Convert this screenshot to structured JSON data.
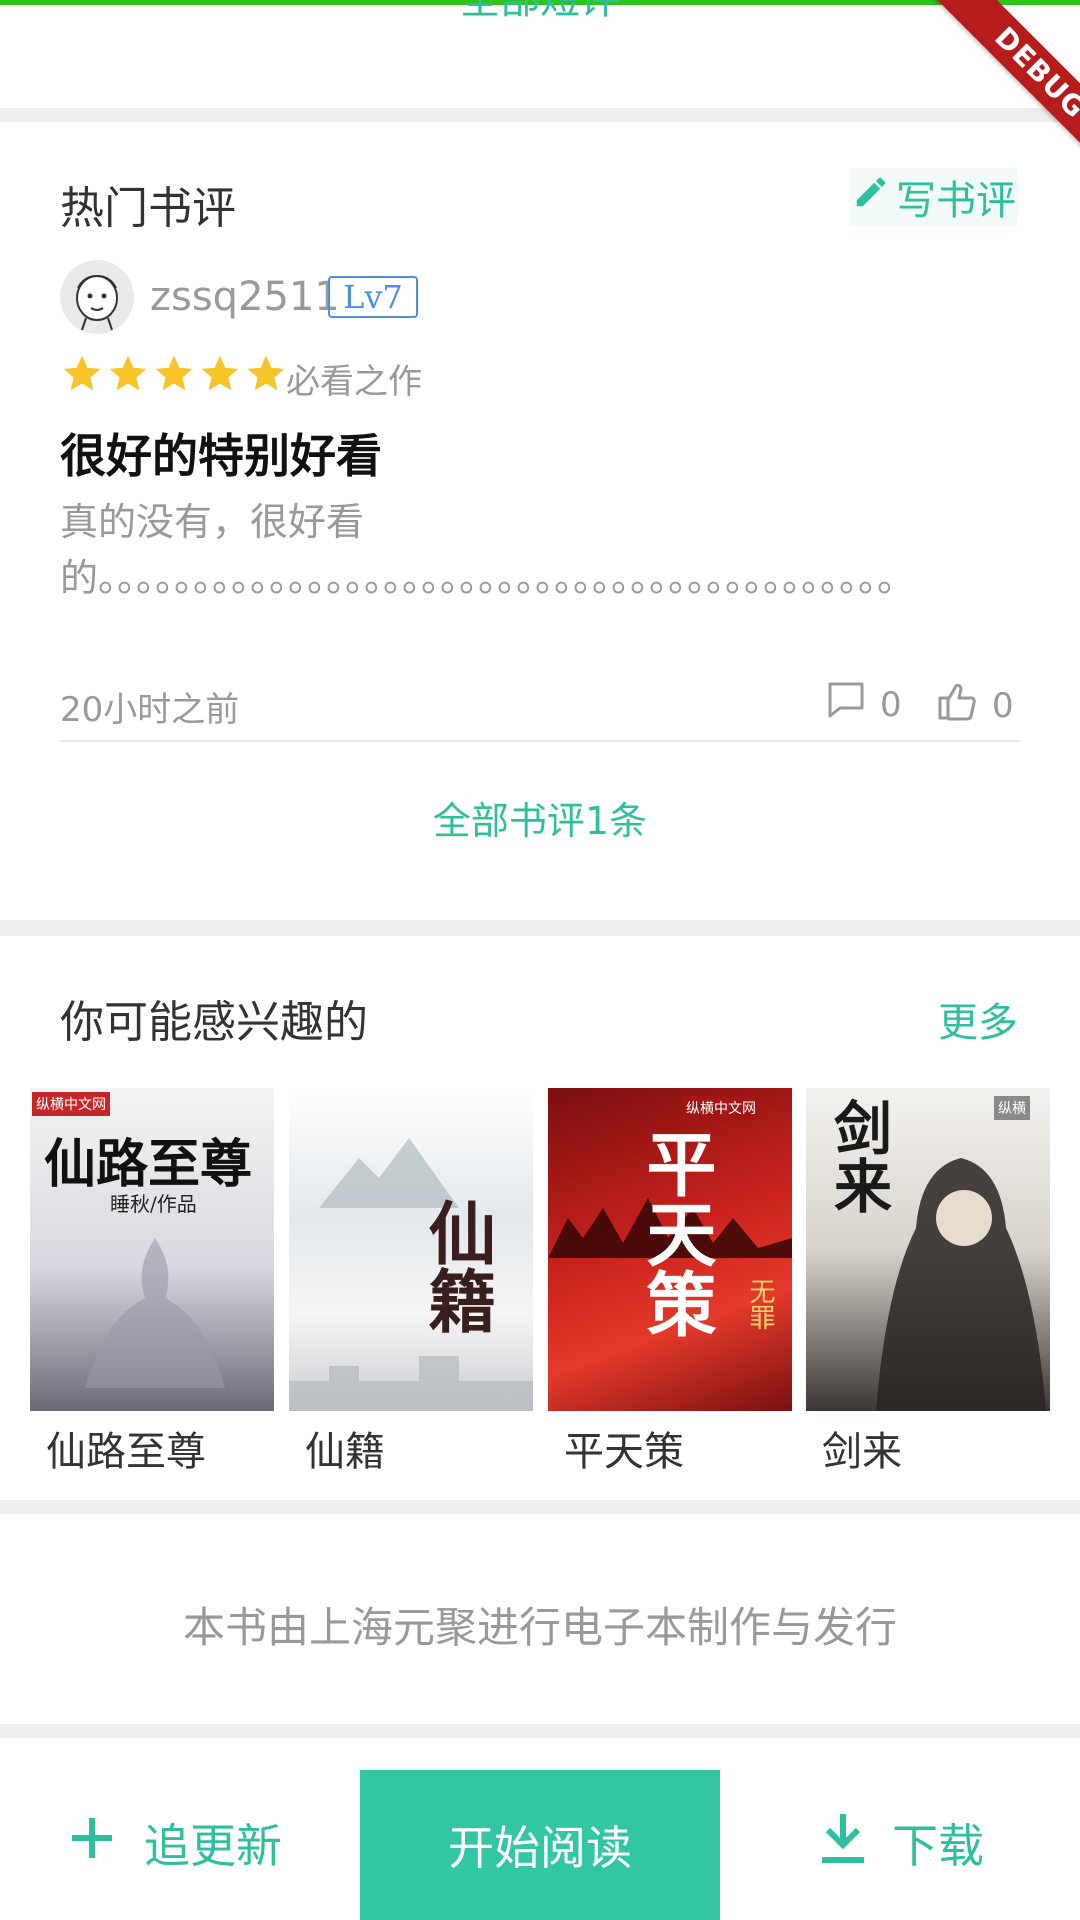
{
  "top": {
    "partial_link": "全部短评",
    "debug_label": "DEBUG"
  },
  "reviews": {
    "section_title": "热门书评",
    "write_label": "写书评",
    "item": {
      "username": "zssq2511",
      "level": "Lv7",
      "rating": 5,
      "rating_max": 5,
      "rating_label": "必看之作",
      "title": "很好的特别好看",
      "body": "真的没有，很好看的。。。。。。。。。。。。。。。。。。。。。。。。。。。。。。。。。。。。。。。。。。",
      "time": "20小时之前",
      "comment_count": "0",
      "like_count": "0"
    },
    "all_label": "全部书评1条"
  },
  "recommend": {
    "section_title": "你可能感兴趣的",
    "more_label": "更多",
    "books": [
      {
        "title": "仙路至尊",
        "cover_text": "仙路至尊",
        "cover_sub": "睡秋/作品",
        "cover_tag": "纵横中文网"
      },
      {
        "title": "仙籍",
        "cover_text": "仙籍",
        "cover_sub": "",
        "cover_tag": ""
      },
      {
        "title": "平天策",
        "cover_text": "平天策",
        "cover_sub": "无罪",
        "cover_tag": "纵横中文网"
      },
      {
        "title": "剑来",
        "cover_text": "剑来",
        "cover_sub": "",
        "cover_tag": "纵横"
      }
    ]
  },
  "footer_note": "本书由上海元聚进行电子本制作与发行",
  "bottom_bar": {
    "follow_label": "追更新",
    "read_label": "开始阅读",
    "download_label": "下载"
  },
  "colors": {
    "accent": "#2fbf9f",
    "star": "#f6c428",
    "badge": "#4a90e2",
    "debug": "#b71c1c"
  }
}
